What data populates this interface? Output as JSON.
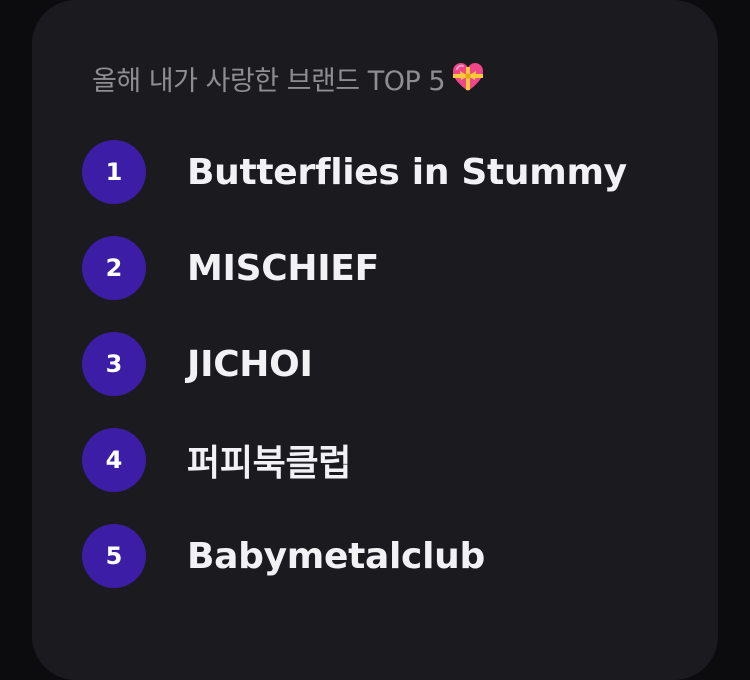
{
  "card": {
    "title": "올해 내가 사랑한 브랜드 TOP 5",
    "title_icon": "heart-with-ribbon-icon"
  },
  "brands": [
    {
      "rank": "1",
      "name": "Butterflies in Stummy"
    },
    {
      "rank": "2",
      "name": "MISCHIEF"
    },
    {
      "rank": "3",
      "name": "JICHOI"
    },
    {
      "rank": "4",
      "name": "퍼피북클럽"
    },
    {
      "rank": "5",
      "name": "Babymetalclub"
    }
  ],
  "colors": {
    "background": "#0c0c0e",
    "card": "#1b1a1f",
    "badge": "#3b1da6",
    "title_text": "#8e8d93",
    "brand_text": "#f2f2f4"
  }
}
